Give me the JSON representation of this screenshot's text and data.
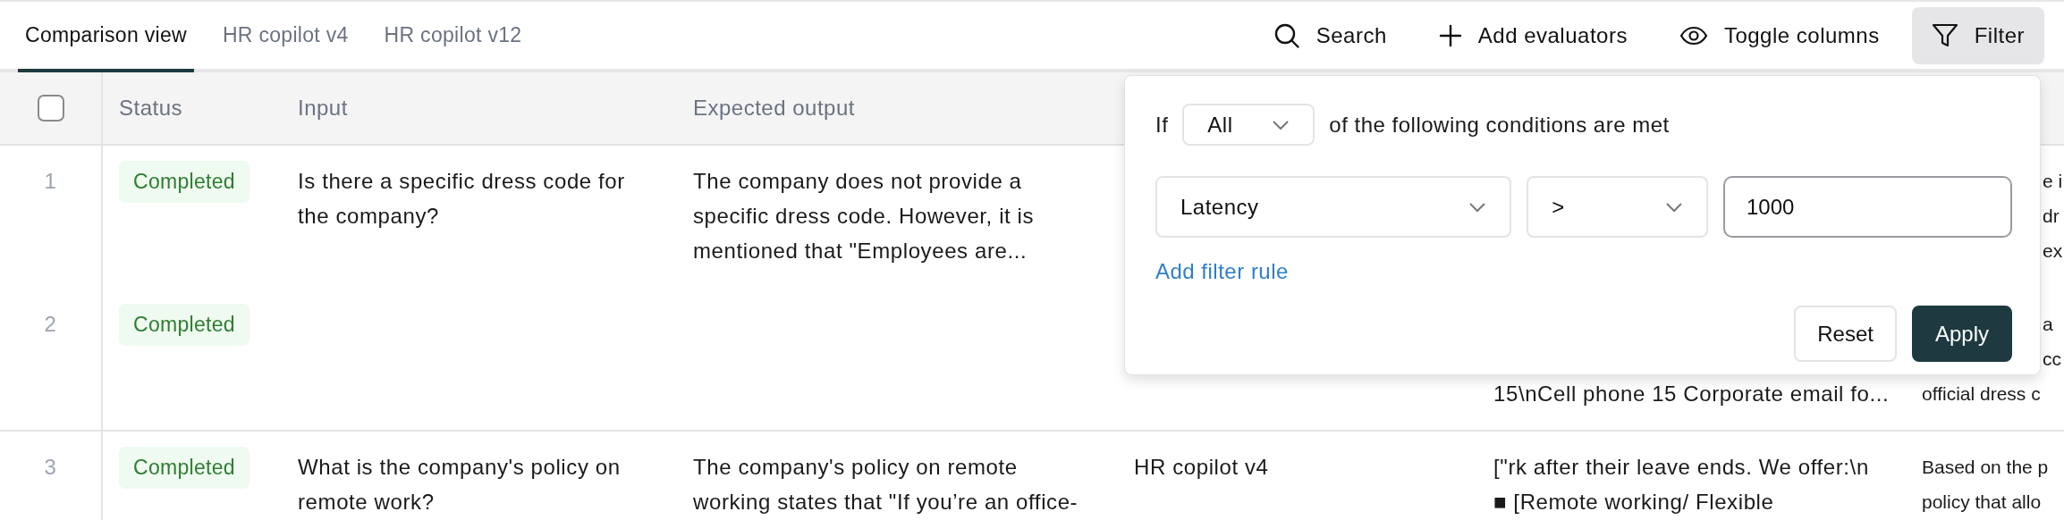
{
  "tabs": [
    {
      "label": "Comparison view",
      "selected": true
    },
    {
      "label": "HR copilot v4",
      "selected": false
    },
    {
      "label": "HR copilot v12",
      "selected": false
    }
  ],
  "toolbar": [
    {
      "kind": "search",
      "label": "Search",
      "selected": false
    },
    {
      "kind": "add",
      "label": "Add evaluators",
      "selected": false
    },
    {
      "kind": "toggle",
      "label": "Toggle columns",
      "selected": false
    },
    {
      "kind": "filter",
      "label": "Filter",
      "selected": true
    }
  ],
  "table": {
    "select_all": {
      "checked": false
    },
    "columns": [
      "Status",
      "Input",
      "Expected output"
    ],
    "rows": [
      {
        "number": "1",
        "status": "Completed",
        "input": "Is there a specific dress code for\nthe company?",
        "expected_output": "The company does not provide a\nspecific dress code. However, it is\nmentioned that \"Employees are...",
        "column_6": {
          "fragments": [
            {
              "kind": "clipped",
              "text": "e i"
            },
            {
              "kind": "clipped",
              "text": "dr"
            },
            {
              "kind": "clipped",
              "text": "ex"
            }
          ]
        }
      },
      {
        "number": "2",
        "status": "Completed",
        "column_5": {
          "fragments": [
            {
              "kind": "line",
              "text": "15\\nCell phone 15 Corporate email fo..."
            }
          ]
        },
        "column_6": {
          "fragments": [
            {
              "kind": "clipped",
              "text": "a"
            },
            {
              "kind": "clipped",
              "text": "cc"
            },
            {
              "kind": "line",
              "text": "official dress c"
            }
          ]
        }
      },
      {
        "number": "3",
        "status": "Completed",
        "input": "What is the company's policy on\nremote work?",
        "expected_output": "The company's policy on remote\nworking states that \"If you’re an office-",
        "column_4": "HR copilot v4",
        "column_5": "[\"rk after their leave ends. We offer:\\n\n■ [Remote working/ Flexible",
        "column_6": "Based on the p\npolicy that allo"
      }
    ]
  },
  "filter_popover": {
    "lead": "If",
    "match": "All",
    "tail": "of the following conditions are met",
    "rules": [
      {
        "field": "Latency",
        "operator": ">",
        "value": "1000"
      }
    ],
    "add_rule": "Add filter rule",
    "buttons": [
      {
        "kind": "secondary",
        "label": "Reset"
      },
      {
        "kind": "primary",
        "label": "Apply"
      }
    ]
  }
}
